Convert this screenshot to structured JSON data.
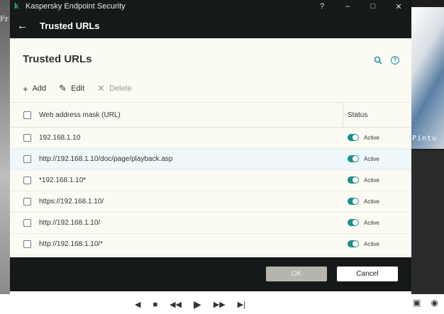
{
  "app": {
    "title": "Kaspersky Endpoint Security",
    "logo_letter": "k",
    "window_controls": {
      "help": "?",
      "minimize": "–",
      "maximize": "□",
      "close": "✕"
    }
  },
  "header": {
    "back": "←",
    "title": "Trusted URLs"
  },
  "panel": {
    "title": "Trusted URLs"
  },
  "toolbar": {
    "add_label": "Add",
    "edit_label": "Edit",
    "delete_label": "Delete"
  },
  "table": {
    "columns": {
      "url": "Web address mask (URL)",
      "status": "Status"
    },
    "rows": [
      {
        "url": "192.168.1.10",
        "status": "Active"
      },
      {
        "url": "http://192.168.1.10/doc/page/playback.asp",
        "status": "Active"
      },
      {
        "url": "*192.168.1.10*",
        "status": "Active"
      },
      {
        "url": "https://192.168.1.10/",
        "status": "Active"
      },
      {
        "url": "http://192.168.1.10/",
        "status": "Active"
      },
      {
        "url": "http://192.168.1.10/*",
        "status": "Active"
      }
    ]
  },
  "buttons": {
    "ok": "OK",
    "cancel": "Cancel"
  },
  "background": {
    "left_fragment": "Fr",
    "camera_text": "Pintu"
  },
  "colors": {
    "accent": "#1e8f8a",
    "titlebar": "#16191a",
    "panel": "#fbfbf4"
  }
}
